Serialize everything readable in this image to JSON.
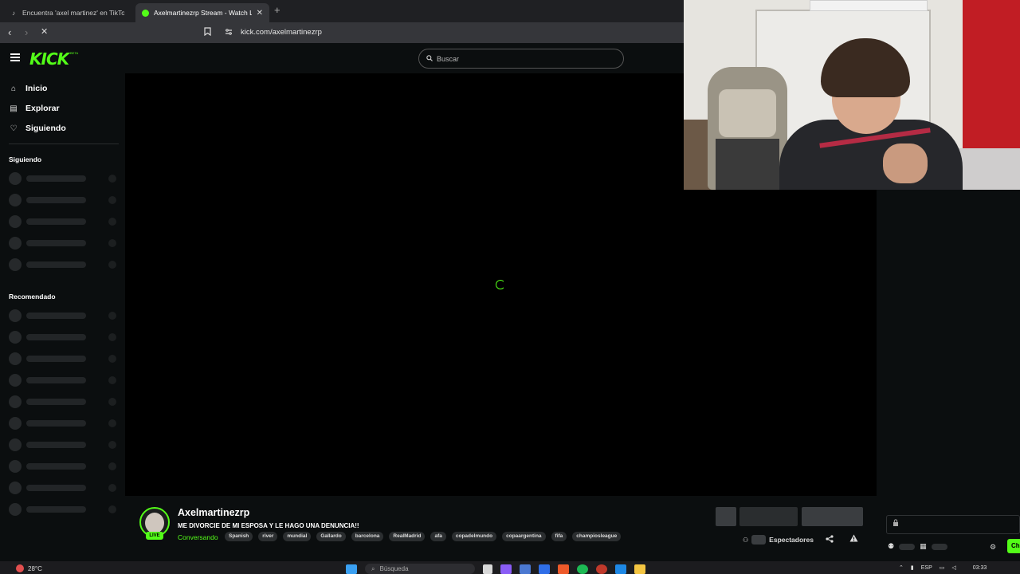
{
  "browser": {
    "tabs": [
      {
        "title": "Encuentra 'axel martinez' en TikTok |",
        "active": false,
        "icon": "tiktok-icon"
      },
      {
        "title": "Axelmartinezrp Stream - Watch L",
        "active": true,
        "icon": "kick-favicon-icon"
      }
    ],
    "url": "kick.com/axelmartinezrp"
  },
  "kick": {
    "logo": "KICK",
    "logo_badge": "BETA",
    "search_placeholder": "Buscar",
    "nav": [
      {
        "label": "Inicio",
        "icon": "home-icon"
      },
      {
        "label": "Explorar",
        "icon": "compass-icon"
      },
      {
        "label": "Siguiendo",
        "icon": "heart-icon"
      }
    ],
    "sections": {
      "following": "Siguiendo",
      "recommended": "Recomendado"
    },
    "accent_color": "#53fc18"
  },
  "stream": {
    "channel_name": "Axelmartinezrp",
    "live_badge": "LIVE",
    "title": "ME DIVORCIE DE MI ESPOSA Y LE HAGO UNA DENUNCIA!!",
    "category": "Conversando",
    "tags": [
      "Spanish",
      "river",
      "mundial",
      "Gallardo",
      "barcelona",
      "RealMadrid",
      "afa",
      "copadelmundo",
      "copaargentina",
      "fifa",
      "champiosleague"
    ],
    "viewers_label": "Espectadores"
  },
  "chat": {
    "send_label": "Ch"
  },
  "taskbar": {
    "temperature": "28°C",
    "search_placeholder": "Búsqueda",
    "language": "ESP",
    "time": "03:33"
  }
}
